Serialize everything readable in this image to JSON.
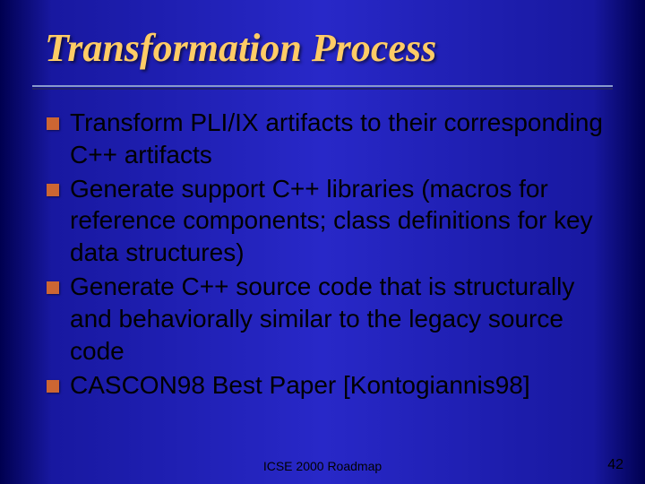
{
  "title": "Transformation Process",
  "bullets": [
    "Transform PLI/IX artifacts to their corresponding C++ artifacts",
    "Generate support  C++ libraries (macros for reference components; class definitions for key data structures)",
    "Generate C++ source code that is structurally and behaviorally similar  to the legacy source code",
    "CASCON98 Best Paper [Kontogiannis98]"
  ],
  "footer_center": "ICSE 2000 Roadmap",
  "footer_right": "42"
}
